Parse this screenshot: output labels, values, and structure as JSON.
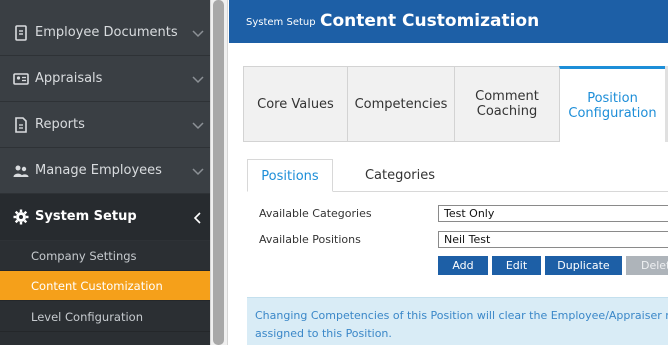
{
  "sidebar": {
    "items": [
      {
        "label": "Employee Documents",
        "icon": "document-icon"
      },
      {
        "label": "Appraisals",
        "icon": "id-card-icon"
      },
      {
        "label": "Reports",
        "icon": "report-icon"
      },
      {
        "label": "Manage Employees",
        "icon": "users-icon"
      },
      {
        "label": "System Setup",
        "icon": "gear-icon"
      }
    ],
    "subitems": [
      {
        "label": "Company Settings"
      },
      {
        "label": "Content Customization"
      },
      {
        "label": "Level Configuration"
      }
    ],
    "active_item": "System Setup",
    "active_subitem": "Content Customization"
  },
  "header": {
    "breadcrumb": "System Setup",
    "title": "Content Customization"
  },
  "tabs": [
    {
      "label": "Core Values"
    },
    {
      "label": "Competencies"
    },
    {
      "label": "Comment Coaching"
    },
    {
      "label": "Position Configuration"
    }
  ],
  "active_tab": "Position Configuration",
  "subtabs": [
    {
      "label": "Positions"
    },
    {
      "label": "Categories"
    }
  ],
  "active_subtab": "Positions",
  "form": {
    "categories_label": "Available Categories",
    "categories_value": "Test Only",
    "positions_label": "Available Positions",
    "positions_value": "Neil Test"
  },
  "buttons": {
    "add": "Add",
    "edit": "Edit",
    "duplicate": "Duplicate",
    "delete": "Delete"
  },
  "info": {
    "line1": "Changing Competencies of this Position will clear the Employee/Appraiser ready da",
    "line2": "assigned to this Position."
  },
  "colors": {
    "header_bg": "#1d5fa6",
    "sidebar_bg": "#3a3f44",
    "active_subitem_bg": "#f5a01a",
    "accent": "#1d8ed8",
    "button_bg": "#1d5fa6",
    "info_bg": "#d9ecf6"
  }
}
